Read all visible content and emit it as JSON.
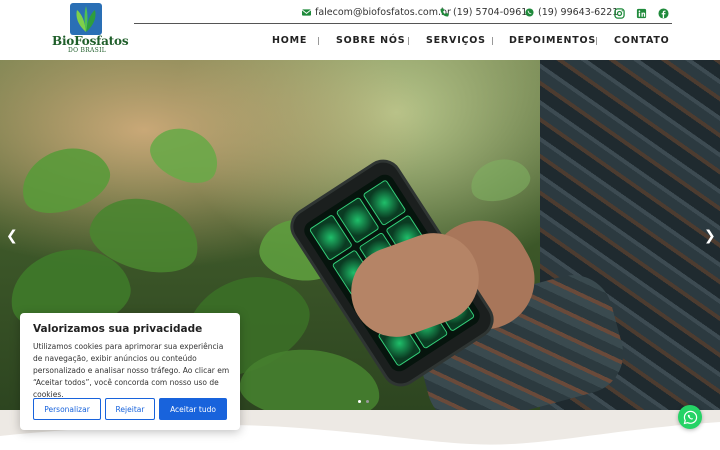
{
  "brand": {
    "name_part1": "Bio",
    "name_part2": "Fosfatos",
    "subtitle": "DO BRASIL",
    "color": "#1f5e2a"
  },
  "contacts": {
    "email": "falecom@biofosfatos.com.br",
    "phone": "(19) 5704-0961",
    "whatsapp": "(19) 99643-6221"
  },
  "social": [
    "instagram-icon",
    "linkedin-icon",
    "facebook-icon"
  ],
  "nav": {
    "items": [
      {
        "label": "HOME"
      },
      {
        "label": "SOBRE NÓS"
      },
      {
        "label": "SERVIÇOS"
      },
      {
        "label": "DEPOIMENTOS"
      },
      {
        "label": "CONTATO"
      }
    ]
  },
  "cookie": {
    "title": "Valorizamos sua privacidade",
    "text": "Utilizamos cookies para aprimorar sua experiência de navegação, exibir anúncios ou conteúdo personalizado e analisar nosso tráfego. Ao clicar em “Aceitar todos”, você concorda com nosso uso de cookies.",
    "customize": "Personalizar",
    "reject": "Rejeitar",
    "accept": "Aceitar tudo",
    "accent": "#1863dc"
  },
  "colors": {
    "accent_green": "#1f8a3b",
    "whatsapp": "#25d366"
  }
}
